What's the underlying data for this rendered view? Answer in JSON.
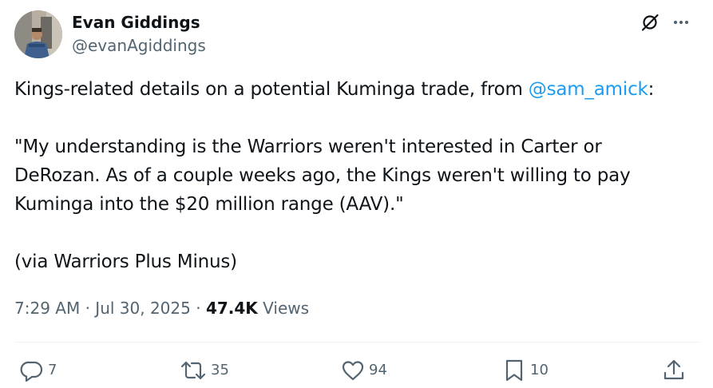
{
  "author": {
    "name": "Evan Giddings",
    "handle": "@evanAgiddings"
  },
  "tweet": {
    "line1_prefix": "Kings-related details on a potential Kuminga trade, from ",
    "mention": "@sam_amick",
    "line1_suffix": ":",
    "quote_lines": [
      "\"My understanding is the Warriors weren't interested in Carter or",
      "DeRozan. As of a couple weeks ago, the Kings weren't willing to pay",
      "Kuminga into the $20 million range (AAV).\""
    ],
    "source": "(via Warriors Plus Minus)"
  },
  "meta": {
    "time": "7:29 AM",
    "separator": "·",
    "date": "Jul 30, 2025",
    "views_count": "47.4K",
    "views_label": "Views"
  },
  "actions": {
    "replies": "7",
    "reposts": "35",
    "likes": "94",
    "bookmarks": "10"
  },
  "icons": {
    "header": [
      "grok-icon",
      "more-icon"
    ],
    "actions": [
      "reply-icon",
      "repost-icon",
      "like-icon",
      "bookmark-icon",
      "share-icon"
    ]
  },
  "colors": {
    "text": "#0f1419",
    "secondary": "#536471",
    "link": "#1d9bf0",
    "divider": "#eff3f4"
  }
}
